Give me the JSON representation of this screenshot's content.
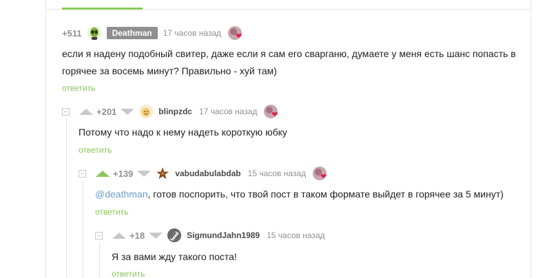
{
  "comments": [
    {
      "rating": "+511",
      "username": "Deathman",
      "time": "17 часов назад",
      "text": "если я надену подобный свитер, даже если я сам его сварганю, думаете у меня есть шанс попасть в горячее за восемь минут? Правильно - хуй там)",
      "reply": "ответить"
    },
    {
      "rating": "+201",
      "username": "blinpzdc",
      "time": "17 часов назад",
      "text": "Потому что надо к нему надеть короткую юбку",
      "reply": "ответить"
    },
    {
      "rating": "+139",
      "username": "vabudabulabdab",
      "time": "15 часов назад",
      "mention": "@deathman",
      "text": ", готов поспорить, что твой пост в таком формате выйдет в горячее за 5 минут)",
      "reply": "ответить"
    },
    {
      "rating": "+18",
      "username": "SigmundJahn1989",
      "time": "15 часов назад",
      "text": "Я за вами жду такого поста!",
      "reply": "ответить"
    }
  ],
  "colors": {
    "accent_green": "#8ac858",
    "link_blue": "#6f9dcc",
    "muted": "#8f8f8f"
  }
}
